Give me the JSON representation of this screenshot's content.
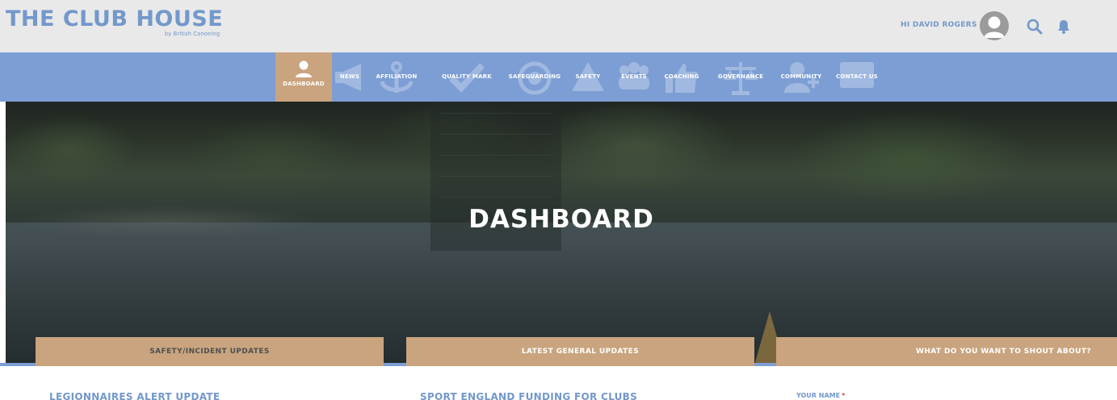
{
  "header": {
    "logo_title": "THE CLUB HOUSE",
    "logo_subtitle": "by British Canoeing",
    "greeting": "HI DAVID ROGERS",
    "icons": [
      "avatar-icon",
      "search-icon",
      "bell-icon"
    ]
  },
  "nav": {
    "items": [
      {
        "label": "DASHBOARD",
        "icon": "person-icon",
        "active": true
      },
      {
        "label": "NEWS",
        "icon": "megaphone-icon"
      },
      {
        "label": "AFFILIATION",
        "icon": "anchor-icon"
      },
      {
        "label": "QUALITY MARK",
        "icon": "checkmark-icon"
      },
      {
        "label": "SAFEGUARDING",
        "icon": "shield-icon"
      },
      {
        "label": "SAFETY",
        "icon": "warning-icon"
      },
      {
        "label": "EVENTS",
        "icon": "group-icon"
      },
      {
        "label": "COACHING",
        "icon": "thumbs-up-icon"
      },
      {
        "label": "GOVERNANCE",
        "icon": "scales-icon"
      },
      {
        "label": "COMMUNITY",
        "icon": "add-user-icon"
      },
      {
        "label": "CONTACT US",
        "icon": "envelope-icon"
      }
    ]
  },
  "hero": {
    "title": "DASHBOARD"
  },
  "cards": {
    "safety": {
      "header": "SAFETY/INCIDENT UPDATES",
      "title": "LEGIONNAIRES ALERT UPDATE"
    },
    "general": {
      "header": "LATEST GENERAL UPDATES",
      "title": "SPORT ENGLAND FUNDING FOR CLUBS"
    },
    "shout": {
      "header": "WHAT DO YOU WANT TO SHOUT ABOUT?",
      "name_label": "YOUR NAME",
      "required_mark": "*"
    }
  },
  "colors": {
    "brand_blue": "#7398cb",
    "nav_blue": "#7d9ed4",
    "tan": "#c9a47e",
    "header_gray": "#e9e9e9"
  }
}
